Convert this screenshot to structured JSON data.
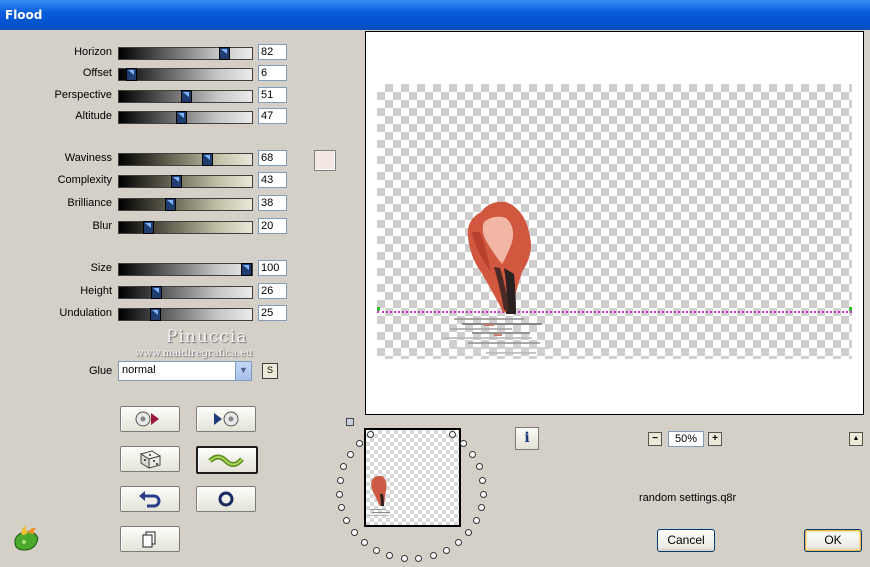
{
  "window": {
    "title": "Flood"
  },
  "sliders": [
    {
      "id": "horizon",
      "label": "Horizon",
      "value": "82",
      "level": 0.82,
      "style": "gray"
    },
    {
      "id": "offset",
      "label": "Offset",
      "value": "6",
      "level": 0.06,
      "style": "gray"
    },
    {
      "id": "perspective",
      "label": "Perspective",
      "value": "51",
      "level": 0.51,
      "style": "gray"
    },
    {
      "id": "altitude",
      "label": "Altitude",
      "value": "47",
      "level": 0.47,
      "style": "gray"
    },
    {
      "id": "waviness",
      "label": "Waviness",
      "value": "68",
      "level": 0.68,
      "style": "green"
    },
    {
      "id": "complexity",
      "label": "Complexity",
      "value": "43",
      "level": 0.43,
      "style": "green"
    },
    {
      "id": "brilliance",
      "label": "Brilliance",
      "value": "38",
      "level": 0.38,
      "style": "green"
    },
    {
      "id": "blur",
      "label": "Blur",
      "value": "20",
      "level": 0.2,
      "style": "green"
    },
    {
      "id": "size",
      "label": "Size",
      "value": "100",
      "level": 1.0,
      "style": "gray"
    },
    {
      "id": "height",
      "label": "Height",
      "value": "26",
      "level": 0.26,
      "style": "gray"
    },
    {
      "id": "undulation",
      "label": "Undulation",
      "value": "25",
      "level": 0.25,
      "style": "gray"
    }
  ],
  "color_swatch": "#f5e8e4",
  "watermark": {
    "line1": "Pinuccia",
    "line2": "www.maidiregrafica.eu"
  },
  "glue": {
    "label": "Glue",
    "value": "normal"
  },
  "s_button": "S",
  "zoom": {
    "value": "50%",
    "minus": "−",
    "plus": "+"
  },
  "settings_file": "random settings.q8r",
  "buttons": {
    "cancel": "Cancel",
    "ok": "OK"
  },
  "info_button": "i"
}
